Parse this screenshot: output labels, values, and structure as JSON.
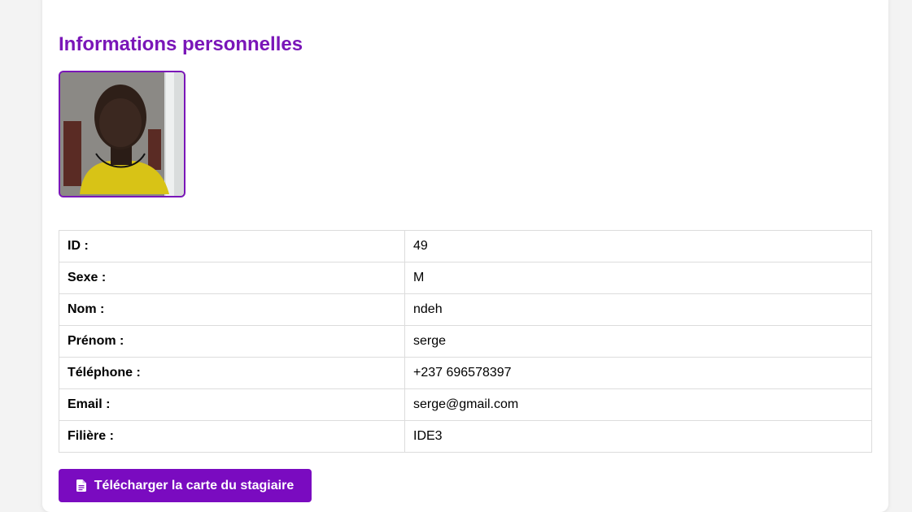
{
  "section": {
    "title": "Informations personnelles"
  },
  "details": [
    {
      "label": "ID :",
      "value": "49"
    },
    {
      "label": "Sexe :",
      "value": "M"
    },
    {
      "label": "Nom :",
      "value": "ndeh"
    },
    {
      "label": "Prénom :",
      "value": "serge"
    },
    {
      "label": "Téléphone :",
      "value": "+237 696578397"
    },
    {
      "label": "Email :",
      "value": "serge@gmail.com"
    },
    {
      "label": "Filière :",
      "value": "IDE3"
    }
  ],
  "download_button": {
    "label": "Télécharger la carte du stagiaire",
    "icon": "file-icon"
  },
  "colors": {
    "accent": "#7a16b8",
    "button": "#7a0bc0"
  }
}
